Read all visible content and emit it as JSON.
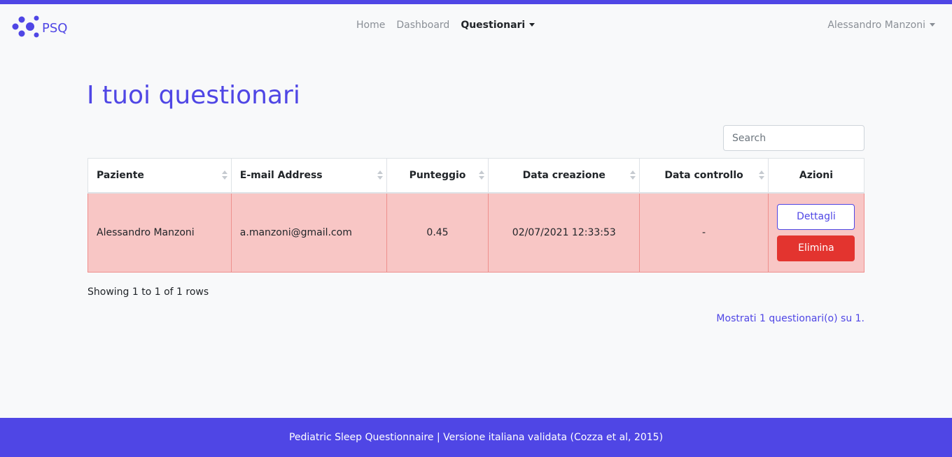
{
  "colors": {
    "accent": "#4f46e5",
    "danger": "#e3342f",
    "row_bg": "#f8c6c5"
  },
  "brand": {
    "name": "PSQ",
    "logo_icon": "dots-network-icon"
  },
  "nav": {
    "home": "Home",
    "dashboard": "Dashboard",
    "questionari": "Questionari",
    "user": "Alessandro Manzoni"
  },
  "page": {
    "title": "I tuoi questionari"
  },
  "search": {
    "placeholder": "Search",
    "value": ""
  },
  "table": {
    "headers": [
      "Paziente",
      "E-mail Address",
      "Punteggio",
      "Data creazione",
      "Data controllo",
      "Azioni"
    ],
    "rows": [
      {
        "paziente": "Alessandro Manzoni",
        "email": "a.manzoni@gmail.com",
        "punteggio": "0.45",
        "data_creazione": "02/07/2021 12:33:53",
        "data_controllo": "-",
        "details_label": "Dettagli",
        "delete_label": "Elimina"
      }
    ]
  },
  "pagination": {
    "showing": "Showing 1 to 1 of 1 rows"
  },
  "summary": "Mostrati 1 questionari(o) su 1.",
  "footer": {
    "text": "Pediatric Sleep Questionnaire | Versione italiana validata (Cozza et al, 2015)"
  }
}
